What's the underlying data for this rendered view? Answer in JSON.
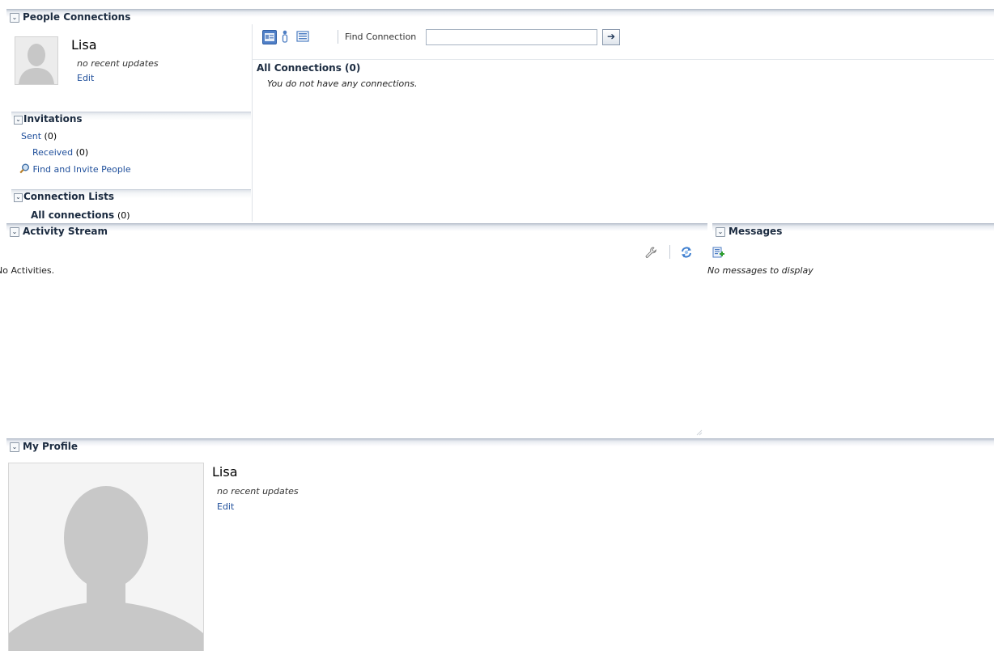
{
  "people_connections": {
    "title": "People Connections",
    "user": {
      "name": "Lisa",
      "status": "no recent updates",
      "edit_label": "Edit"
    },
    "invitations": {
      "title": "Invitations",
      "sent_label": "Sent",
      "sent_count": "(0)",
      "received_label": "Received",
      "received_count": "(0)",
      "find_invite_label": "Find and Invite People"
    },
    "connection_lists": {
      "title": "Connection Lists",
      "all_label": "All connections",
      "all_count": "(0)"
    },
    "toolbar": {
      "find_label": "Find Connection",
      "find_value": "",
      "go_icon": "arrow-right-icon"
    },
    "all_connections": {
      "title": "All Connections",
      "count": "(0)",
      "empty_text": "You do not have any connections."
    }
  },
  "activity_stream": {
    "title": "Activity Stream",
    "empty_text": "No Activities."
  },
  "messages": {
    "title": "Messages",
    "empty_text": "No messages to display"
  },
  "my_profile": {
    "title": "My Profile",
    "name": "Lisa",
    "status": "no recent updates",
    "edit_label": "Edit"
  },
  "colors": {
    "link": "#1f4f9b",
    "header_text": "#1b2b40",
    "header_bar": "#c4cbd5"
  }
}
